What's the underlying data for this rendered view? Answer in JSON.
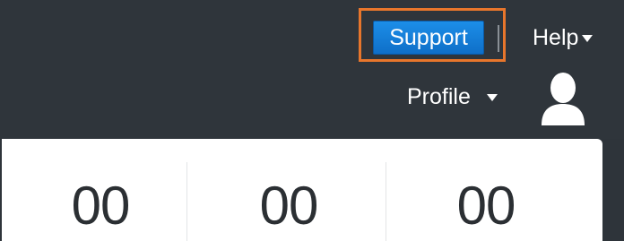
{
  "header": {
    "support_label": "Support",
    "help_label": "Help",
    "profile_label": "Profile"
  },
  "stats": [
    {
      "value": "00"
    },
    {
      "value": "00"
    },
    {
      "value": "00"
    }
  ],
  "colors": {
    "topbar": "#2f353b",
    "support_button": "#1580dc",
    "highlight": "#e8762c",
    "panel": "#ffffff"
  },
  "icons": {
    "help_caret": "chevron-down-icon",
    "profile_caret": "chevron-down-icon",
    "avatar": "user-avatar-icon"
  }
}
